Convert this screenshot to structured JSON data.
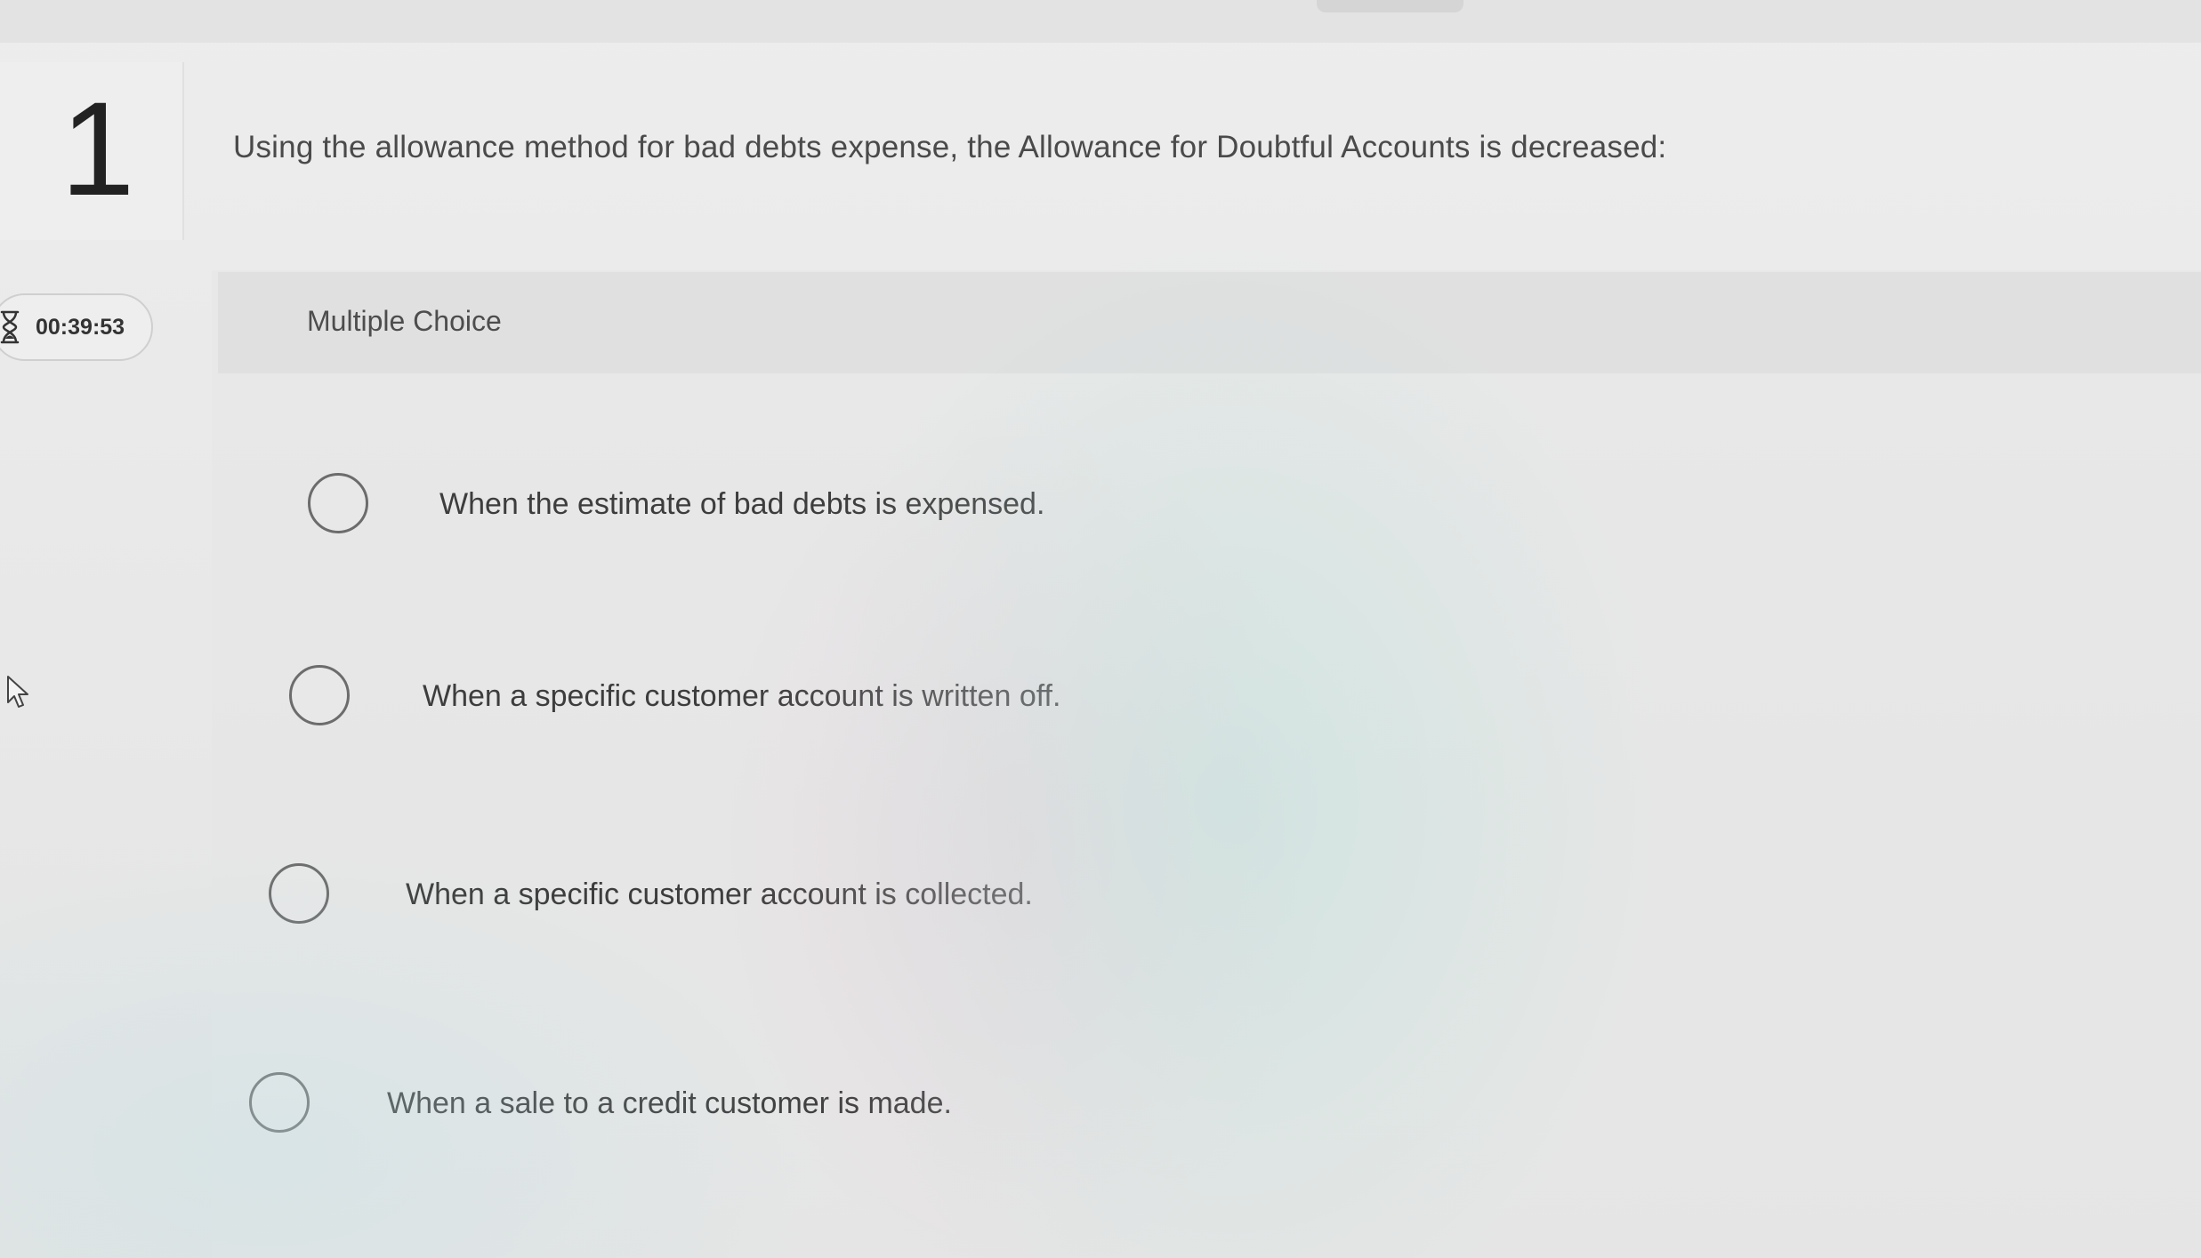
{
  "question": {
    "number": "1",
    "text": "Using the allowance method for bad debts expense, the Allowance for Doubtful Accounts is decreased:"
  },
  "timer": {
    "icon": "hourglass-icon",
    "value": "00:39:53"
  },
  "choices": {
    "type_label": "Multiple Choice",
    "options": [
      {
        "label": "When the estimate of bad debts is expensed.",
        "selected": false
      },
      {
        "label": "When a specific customer account is written off.",
        "selected": false
      },
      {
        "label": "When a specific customer account is collected.",
        "selected": false
      },
      {
        "label": "When a sale to a credit customer is made.",
        "selected": false
      }
    ]
  },
  "colors": {
    "text": "#3d3d3d",
    "radio_border": "#6c6c6c",
    "background": "#ebebeb"
  }
}
